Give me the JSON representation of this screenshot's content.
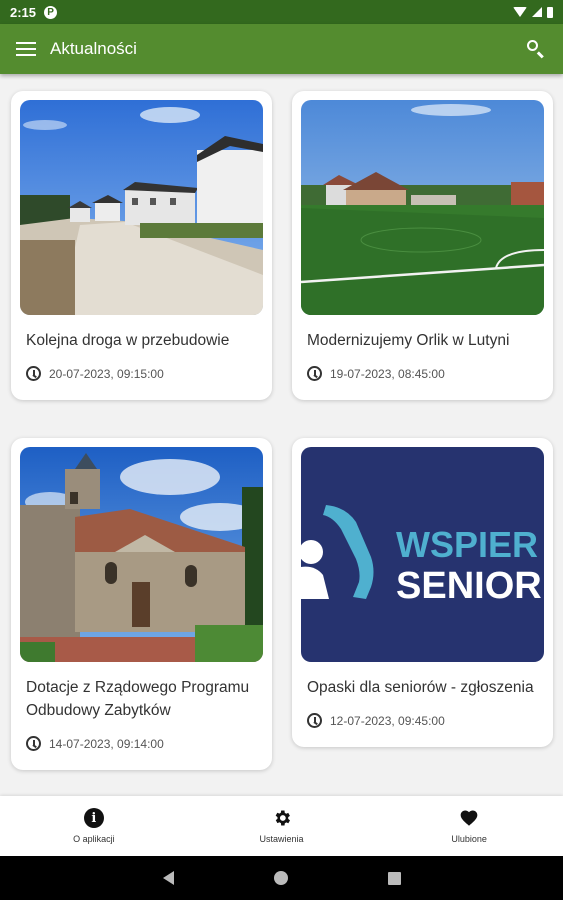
{
  "status_bar": {
    "time": "2:15",
    "indicator": "P"
  },
  "app_bar": {
    "title": "Aktualności"
  },
  "colors": {
    "status_bar": "#33691e",
    "app_bar": "#548c2f",
    "senior_bg": "#26336f",
    "senior_accent": "#4fb0cf"
  },
  "cards": [
    {
      "title": "Kolejna droga w przebudowie",
      "date": "20-07-2023, 09:15:00"
    },
    {
      "title": "Modernizujemy Orlik w Lutyni",
      "date": "19-07-2023, 08:45:00"
    },
    {
      "title": "Dotacje z Rządowego Programu Odbudowy Zabytków",
      "date": "14-07-2023, 09:14:00"
    },
    {
      "title": "Opaski dla seniorów - zgłoszenia",
      "date": "12-07-2023, 09:45:00",
      "image_text": {
        "line1": "WSPIER",
        "line2": "SENIOR"
      }
    }
  ],
  "bottom_nav": [
    {
      "label": "O aplikacji",
      "icon": "info-icon"
    },
    {
      "label": "Ustawienia",
      "icon": "gear-icon"
    },
    {
      "label": "Ulubione",
      "icon": "heart-icon"
    }
  ]
}
